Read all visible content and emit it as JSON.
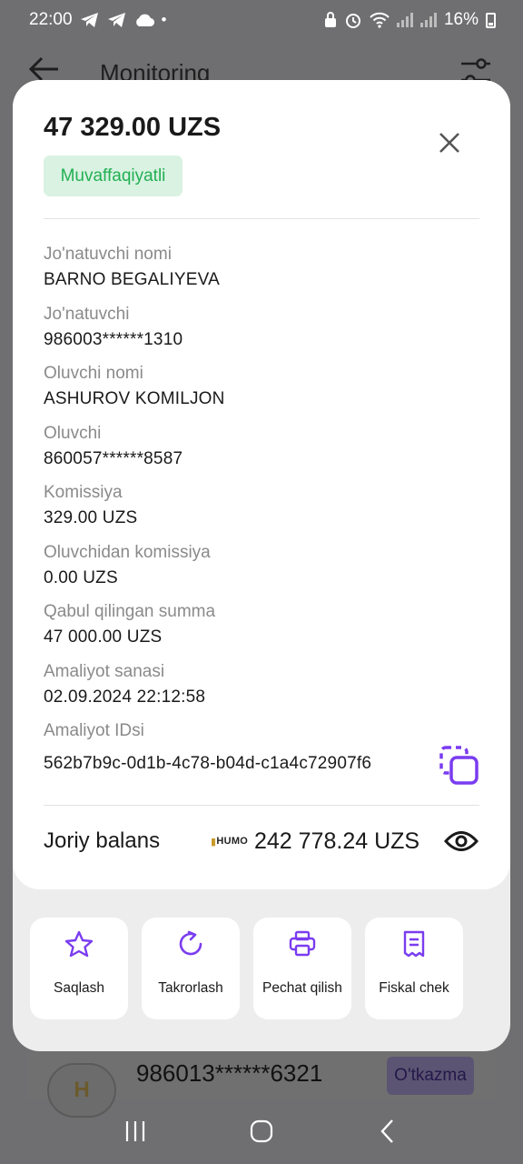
{
  "status_bar": {
    "time": "22:00",
    "battery": "16%"
  },
  "background": {
    "title": "Monitoring",
    "row_card": "986013******6321",
    "row_badge": "O'tkazma",
    "avatar_letter": "H"
  },
  "receipt": {
    "amount": "47 329.00 UZS",
    "status": "Muvaffaqiyatli",
    "fields": [
      {
        "label": "Jo'natuvchi nomi",
        "value": "BARNO BEGALIYEVA"
      },
      {
        "label": "Jo'natuvchi",
        "value": "986003******1310"
      },
      {
        "label": "Oluvchi nomi",
        "value": "ASHUROV KOMILJON"
      },
      {
        "label": "Oluvchi",
        "value": "860057******8587"
      },
      {
        "label": "Komissiya",
        "value": "329.00 UZS"
      },
      {
        "label": "Oluvchidan komissiya",
        "value": "0.00 UZS"
      },
      {
        "label": "Qabul qilingan summa",
        "value": "47 000.00 UZS"
      },
      {
        "label": "Amaliyot sanasi",
        "value": "02.09.2024 22:12:58"
      },
      {
        "label": "Amaliyot IDsi",
        "value": "562b7b9c-0d1b-4c78-b04d-c1a4c72907f6"
      }
    ],
    "balance_label": "Joriy balans",
    "balance_card_brand": "HUMO",
    "balance_amount": "242 778.24 UZS"
  },
  "actions": [
    {
      "label": "Saqlash",
      "icon": "star-icon"
    },
    {
      "label": "Takrorlash",
      "icon": "repeat-icon"
    },
    {
      "label": "Pechat qilish",
      "icon": "printer-icon"
    },
    {
      "label": "Fiskal chek",
      "icon": "receipt-icon"
    }
  ],
  "colors": {
    "accent": "#7a3cf0",
    "success_bg": "#d9f2e2",
    "success_text": "#22b052",
    "overlay": "#6f6f71"
  }
}
